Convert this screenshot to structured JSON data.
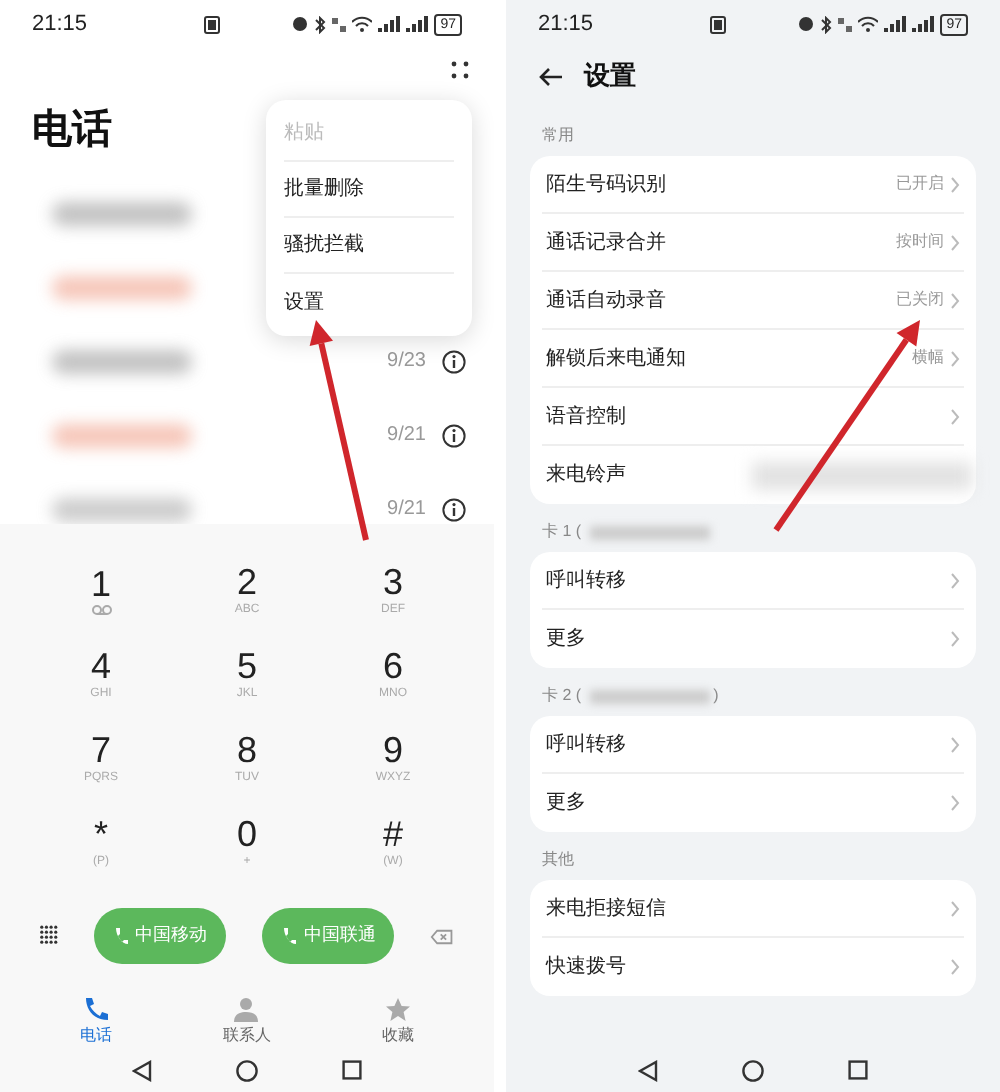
{
  "left": {
    "status_bar": {
      "time": "21:15",
      "battery": "97"
    },
    "title": "电话",
    "menu": [
      {
        "label": "粘贴",
        "disabled": true
      },
      {
        "label": "批量删除",
        "disabled": false
      },
      {
        "label": "骚扰拦截",
        "disabled": false
      },
      {
        "label": "设置",
        "disabled": false
      }
    ],
    "call_log": [
      {
        "date": "9/23"
      },
      {
        "date": "9/21"
      },
      {
        "date": "9/21"
      }
    ],
    "keypad": [
      {
        "digit": "1",
        "kind": "voicemail"
      },
      {
        "digit": "2",
        "letters": "ABC",
        "kind": "letters"
      },
      {
        "digit": "3",
        "letters": "DEF",
        "kind": "letters"
      },
      {
        "digit": "4",
        "letters": "GHI",
        "kind": "letters"
      },
      {
        "digit": "5",
        "letters": "JKL",
        "kind": "letters"
      },
      {
        "digit": "6",
        "letters": "MNO",
        "kind": "letters"
      },
      {
        "digit": "7",
        "letters": "PQRS",
        "kind": "letters"
      },
      {
        "digit": "8",
        "letters": "TUV",
        "kind": "letters"
      },
      {
        "digit": "9",
        "letters": "WXYZ",
        "kind": "letters"
      },
      {
        "digit": "*",
        "letters": "(P)",
        "kind": "letters"
      },
      {
        "digit": "0",
        "letters": "+",
        "kind": "letters"
      },
      {
        "digit": "#",
        "letters": "(W)",
        "kind": "letters"
      }
    ],
    "call_buttons": [
      {
        "label": "中国移动"
      },
      {
        "label": "中国联通"
      }
    ],
    "tabs": [
      {
        "label": "电话",
        "selected": true,
        "kind": "phone"
      },
      {
        "label": "联系人",
        "selected": false,
        "kind": "contacts"
      },
      {
        "label": "收藏",
        "selected": false,
        "kind": "star"
      }
    ]
  },
  "right": {
    "status_bar": {
      "time": "21:15",
      "battery": "97"
    },
    "title": "设置",
    "sections": [
      {
        "header": "常用",
        "kind": "plain",
        "rows": [
          {
            "label": "陌生号码识别",
            "value": "已开启",
            "kind": "value"
          },
          {
            "label": "通话记录合并",
            "value": "按时间",
            "kind": "value"
          },
          {
            "label": "通话自动录音",
            "value": "已关闭",
            "kind": "value"
          },
          {
            "label": "解锁后来电通知",
            "value": "横幅",
            "kind": "value"
          },
          {
            "label": "语音控制",
            "kind": "link"
          },
          {
            "label": "来电铃声",
            "kind": "blurred"
          }
        ]
      },
      {
        "header": "卡 1 (",
        "kind": "sim",
        "rows": [
          {
            "label": "呼叫转移",
            "kind": "link"
          },
          {
            "label": "更多",
            "kind": "link"
          }
        ]
      },
      {
        "header": "卡 2 (",
        "header_end": ")",
        "kind": "sim",
        "rows": [
          {
            "label": "呼叫转移",
            "kind": "link"
          },
          {
            "label": "更多",
            "kind": "link"
          }
        ]
      },
      {
        "header": "其他",
        "kind": "plain",
        "rows": [
          {
            "label": "来电拒接短信",
            "kind": "link"
          },
          {
            "label": "快速拨号",
            "kind": "link"
          }
        ]
      }
    ]
  }
}
